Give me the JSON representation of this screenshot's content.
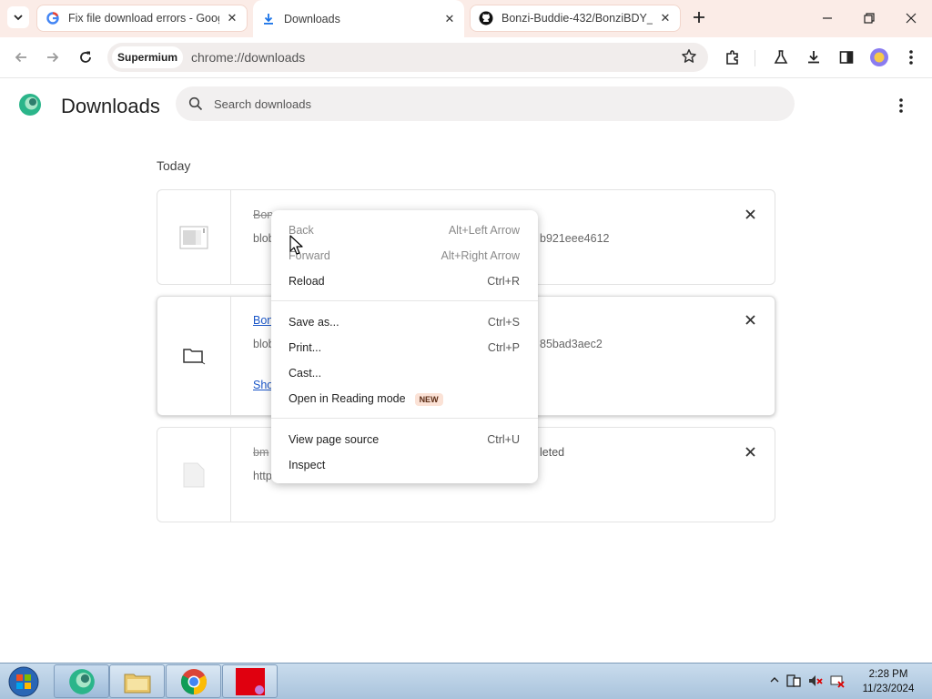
{
  "browser": {
    "tabs": [
      {
        "title": "Fix file download errors - Goog",
        "active": false,
        "favicon": "google-g-icon"
      },
      {
        "title": "Downloads",
        "active": true,
        "favicon": "download-icon"
      },
      {
        "title": "Bonzi-Buddie-432/BonziBDY_3",
        "active": false,
        "favicon": "github-icon"
      }
    ],
    "chip": "Supermium",
    "url": "chrome://downloads"
  },
  "page": {
    "title": "Downloads",
    "search_placeholder": "Search downloads",
    "section": "Today",
    "items": [
      {
        "name": "Bon",
        "url": "blob",
        "url_tail": "b921eee4612",
        "name_style": "strike",
        "icon": "partial-file-icon"
      },
      {
        "name": "Bonz",
        "url": "blob",
        "url_tail": "85bad3aec2",
        "name_style": "link",
        "action": "Sho",
        "icon": "folder-icon"
      },
      {
        "name": "bm",
        "name_tail": "leted",
        "url": "http",
        "name_style": "strike",
        "icon": "blank-file-icon"
      }
    ]
  },
  "context_menu": {
    "groups": [
      [
        {
          "label": "Back",
          "shortcut": "Alt+Left Arrow",
          "disabled": true
        },
        {
          "label": "Forward",
          "shortcut": "Alt+Right Arrow",
          "disabled": true
        },
        {
          "label": "Reload",
          "shortcut": "Ctrl+R",
          "disabled": false
        }
      ],
      [
        {
          "label": "Save as...",
          "shortcut": "Ctrl+S",
          "disabled": false
        },
        {
          "label": "Print...",
          "shortcut": "Ctrl+P",
          "disabled": false
        },
        {
          "label": "Cast...",
          "shortcut": "",
          "disabled": false
        },
        {
          "label": "Open in Reading mode",
          "shortcut": "",
          "badge": "NEW",
          "disabled": false
        }
      ],
      [
        {
          "label": "View page source",
          "shortcut": "Ctrl+U",
          "disabled": false
        },
        {
          "label": "Inspect",
          "shortcut": "",
          "disabled": false
        }
      ]
    ]
  },
  "taskbar": {
    "time": "2:28 PM",
    "date": "11/23/2024"
  }
}
